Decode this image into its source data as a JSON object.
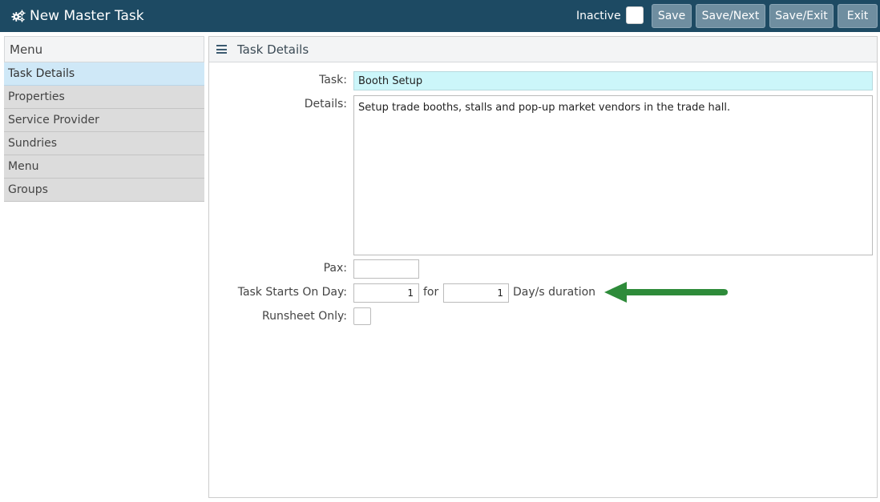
{
  "header": {
    "title": "New Master Task",
    "inactive_label": "Inactive",
    "buttons": {
      "save": "Save",
      "save_next": "Save/Next",
      "save_exit": "Save/Exit",
      "exit": "Exit"
    }
  },
  "sidebar": {
    "title": "Menu",
    "items": [
      {
        "label": "Task Details",
        "active": true
      },
      {
        "label": "Properties"
      },
      {
        "label": "Service Provider"
      },
      {
        "label": "Sundries"
      },
      {
        "label": "Menu"
      },
      {
        "label": "Groups"
      }
    ]
  },
  "panel": {
    "title": "Task Details"
  },
  "form": {
    "task_label": "Task:",
    "task_value": "Booth Setup",
    "details_label": "Details:",
    "details_value": "Setup trade booths, stalls and pop-up market vendors in the trade hall.",
    "pax_label": "Pax:",
    "pax_value": "",
    "starts_label": "Task Starts On Day:",
    "starts_value": "1",
    "for_text": "for",
    "duration_value": "1",
    "duration_text": "Day/s duration",
    "runsheet_label": "Runsheet Only:"
  },
  "colors": {
    "header_bg": "#1d4a63",
    "button_bg": "#6f8ea0",
    "active_item": "#cfe8f7",
    "task_input_bg": "#ccf6fa",
    "arrow": "#2e8b3a"
  },
  "icons": {
    "title_icon": "cogs-icon",
    "panel_icon": "hamburger-icon",
    "annotation": "arrow-left-icon"
  }
}
